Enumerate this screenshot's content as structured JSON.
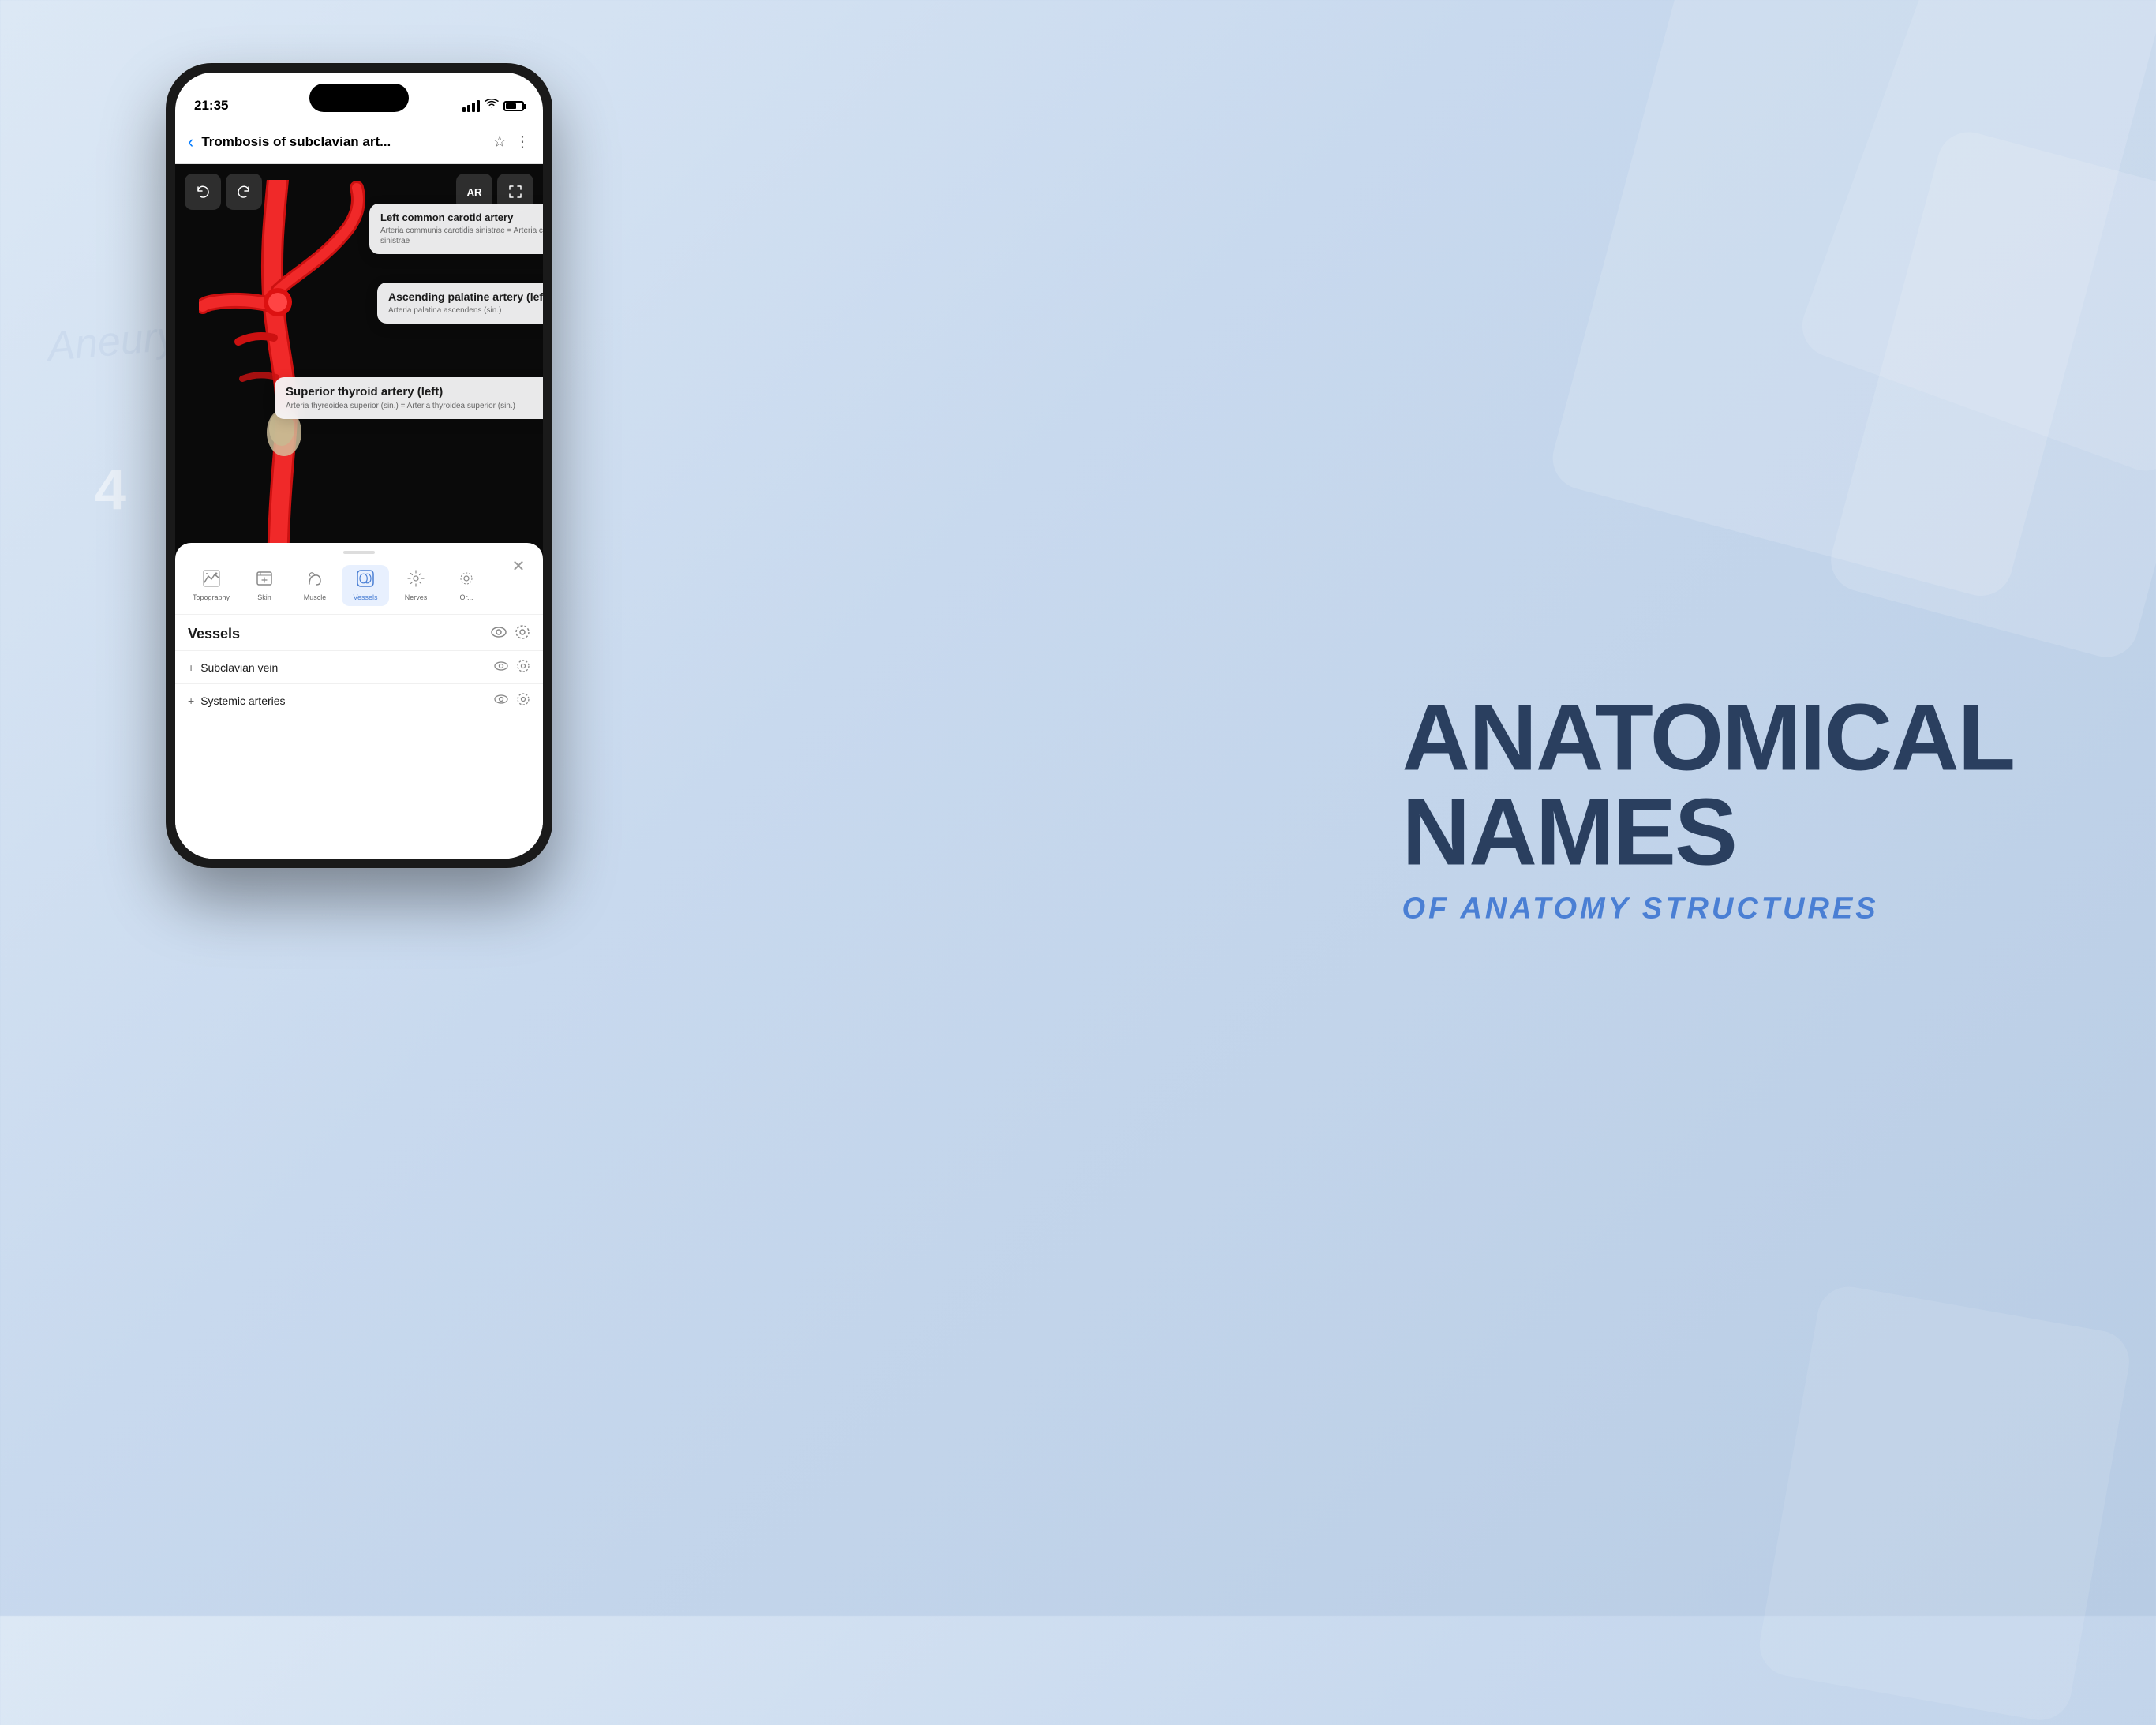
{
  "background": {
    "gradient_start": "#dce8f5",
    "gradient_end": "#b8cce4"
  },
  "bg_text": "Aneurysm",
  "bg_number": "4",
  "status_bar": {
    "time": "21:35",
    "signal": "4 bars",
    "wifi": true,
    "battery": "65%"
  },
  "nav": {
    "back_label": "‹",
    "title": "Trombosis of subclavian art...",
    "star_icon": "☆",
    "more_icon": "⋮"
  },
  "controls": {
    "undo_icon": "↺",
    "redo_icon": "↻",
    "ar_label": "AR",
    "expand_icon": "⤢"
  },
  "tooltips": [
    {
      "title": "Left common carotid artery",
      "subtitle": "Arteria communis carotidis sinistrae = Arteria carotis communis sinistrae"
    },
    {
      "title": "Ascending palatine artery (left)",
      "subtitle": "Arteria palatina ascendens (sin.)"
    },
    {
      "title": "Superior thyroid artery (left)",
      "subtitle": "Arteria thyreoidea superior (sin.) = Arteria thyroidea superior (sin.)"
    }
  ],
  "bottom_sheet": {
    "close_icon": "✕",
    "categories": [
      {
        "icon": "⊞",
        "label": "Topography",
        "active": false
      },
      {
        "icon": "🖼",
        "label": "Skin",
        "active": false
      },
      {
        "icon": "🍃",
        "label": "Muscle",
        "active": false
      },
      {
        "icon": "⊠",
        "label": "Vessels",
        "active": true
      },
      {
        "icon": "✳",
        "label": "Nerves",
        "active": false
      },
      {
        "icon": "⊙",
        "label": "Or...",
        "active": false
      }
    ],
    "section_title": "Vessels",
    "items": [
      {
        "name": "Subclavian vein"
      },
      {
        "name": "Systemic arteries"
      }
    ]
  },
  "right_text": {
    "main_title_line1": "ANATOMICAL",
    "main_title_line2": "NAMES",
    "sub_title": "OF ANATOMY STRUCTURES"
  }
}
